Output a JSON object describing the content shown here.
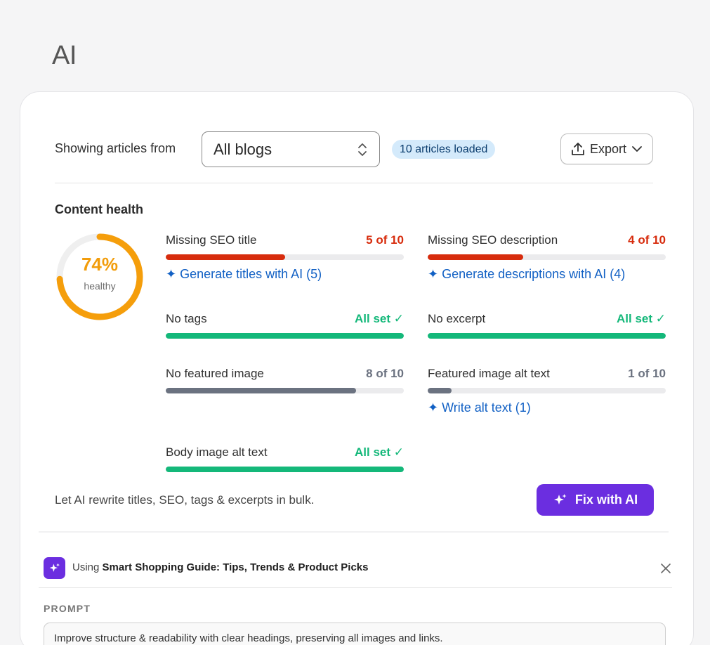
{
  "page": {
    "title": "AI"
  },
  "toolbar": {
    "showing_label": "Showing articles from",
    "blog_select_value": "All blogs",
    "loaded_badge": "10 articles loaded",
    "export_label": "Export"
  },
  "content_health": {
    "title": "Content health",
    "score_text": "74%",
    "score_fraction": 0.74,
    "score_sub": "healthy",
    "metrics": [
      {
        "label": "Missing SEO title",
        "value": "5 of 10",
        "fraction": 0.5,
        "status": "error",
        "action": "✦ Generate titles with AI (5)"
      },
      {
        "label": "Missing SEO description",
        "value": "4 of 10",
        "fraction": 0.4,
        "status": "error",
        "action": "✦ Generate descriptions with AI (4)"
      },
      {
        "label": "No tags",
        "value": "All set ✓",
        "fraction": 1.0,
        "status": "ok",
        "action": ""
      },
      {
        "label": "No excerpt",
        "value": "All set ✓",
        "fraction": 1.0,
        "status": "ok",
        "action": ""
      },
      {
        "label": "No featured image",
        "value": "8 of 10",
        "fraction": 0.8,
        "status": "neutral",
        "action": ""
      },
      {
        "label": "Featured image alt text",
        "value": "1 of 10",
        "fraction": 0.1,
        "status": "neutral",
        "action": "✦ Write alt text (1)"
      },
      {
        "label": "Body image alt text",
        "value": "All set ✓",
        "fraction": 1.0,
        "status": "ok",
        "action": ""
      }
    ],
    "footer_text": "Let AI rewrite titles, SEO, tags & excerpts in bulk.",
    "fix_button": "Fix with AI"
  },
  "colors": {
    "error": "#d72c0d",
    "ok": "#14b87a",
    "neutral": "#6b7280",
    "donut": "#f59e0b",
    "accent": "#6b2ee0",
    "link": "#1160c4"
  },
  "using": {
    "prefix": "Using",
    "guide_name": "Smart Shopping Guide: Tips, Trends & Product Picks"
  },
  "prompt": {
    "label": "PROMPT",
    "text": "Improve structure & readability with clear headings, preserving all images and links."
  }
}
